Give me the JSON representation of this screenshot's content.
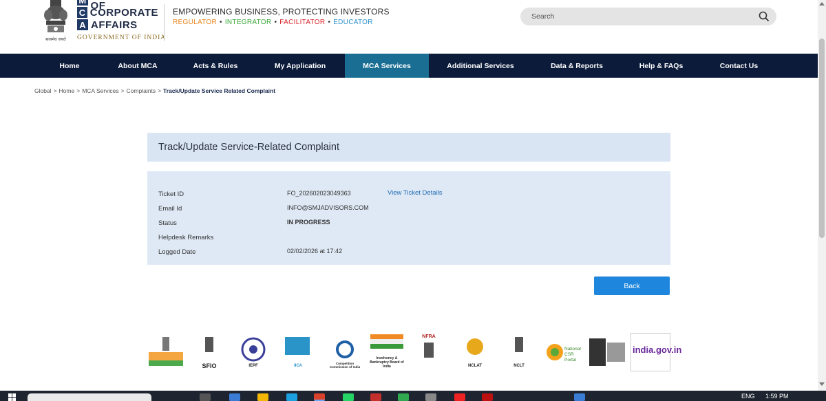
{
  "header": {
    "emblem_caption": "सत्यमेव जयते",
    "logo_letters": [
      "M",
      "C",
      "A"
    ],
    "logo_words": [
      "MINISTRY OF",
      "CORPORATE",
      "AFFAIRS"
    ],
    "government": "GOVERNMENT OF INDIA",
    "tagline": "EMPOWERING BUSINESS, PROTECTING INVESTORS",
    "roles": [
      {
        "label": "REGULATOR",
        "color": "#e8861c"
      },
      {
        "label": "INTEGRATOR",
        "color": "#3aa83a"
      },
      {
        "label": "FACILITATOR",
        "color": "#d8262c"
      },
      {
        "label": "EDUCATOR",
        "color": "#2c8fc9"
      }
    ],
    "search_placeholder": "Search"
  },
  "nav": {
    "items": [
      "Home",
      "About MCA",
      "Acts & Rules",
      "My Application",
      "MCA Services",
      "Additional Services",
      "Data & Reports",
      "Help & FAQs",
      "Contact Us"
    ],
    "active": "MCA Services"
  },
  "breadcrumb": {
    "items": [
      "Global",
      "Home",
      "MCA Services",
      "Complaints"
    ],
    "current": "Track/Update Service Related Complaint"
  },
  "complaint": {
    "title": "Track/Update Service-Related Complaint",
    "labels": {
      "ticket_id": "Ticket ID",
      "email": "Email Id",
      "status": "Status",
      "remarks": "Helpdesk Remarks",
      "logged": "Logged Date"
    },
    "values": {
      "ticket_id": "FO_202602023049363",
      "email": "INFO@SMJADVISORS.COM",
      "status": "IN PROGRESS",
      "remarks": "",
      "logged": "02/02/2026 at 17:42"
    },
    "view_link": "View Ticket Details",
    "back_button": "Back"
  },
  "partners": {
    "captions": [
      "SFIO",
      "IEPF",
      "IICA",
      "Competition Commission of India",
      "Insolvency & Bankruptcy Board of India",
      "NFRA",
      "NCLAT",
      "NCLT",
      "National CSR Portal",
      "india.gov.in"
    ]
  },
  "taskbar": {
    "clock": "1:59 PM",
    "lang": "ENG"
  },
  "colors": {
    "nav_bg": "#0c1b3a",
    "nav_active": "#1a6e93",
    "card_head": "#dae5f3",
    "card_body": "#dfe9f5",
    "button": "#1e86dd",
    "link": "#1f6bb5"
  }
}
